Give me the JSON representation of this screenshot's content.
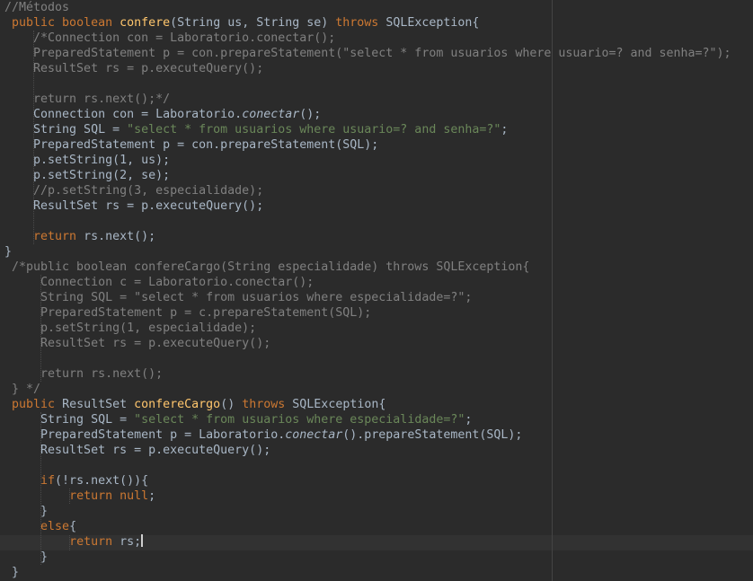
{
  "editor": {
    "colors": {
      "background": "#2b2b2b",
      "text": "#a9b7c6",
      "keyword": "#cc7832",
      "method": "#ffc66d",
      "comment": "#808080",
      "string": "#6a8759"
    },
    "cursor_line": 35,
    "lines": [
      [
        [
          "c",
          "//Métodos"
        ]
      ],
      [
        [
          "p",
          " "
        ],
        [
          "k",
          "public boolean "
        ],
        [
          "m",
          "confere"
        ],
        [
          "p",
          "(String us, String se) "
        ],
        [
          "k",
          "throws"
        ],
        [
          "p",
          " SQLException{"
        ]
      ],
      [
        [
          "c",
          "    /*Connection con = Laboratorio.conectar();"
        ]
      ],
      [
        [
          "c",
          "    PreparedStatement p = con.prepareStatement(\"select * from usuarios where usuario=? and senha=?\");"
        ]
      ],
      [
        [
          "c",
          "    ResultSet rs = p.executeQuery();"
        ]
      ],
      [],
      [
        [
          "c",
          "    return rs.next();*/"
        ]
      ],
      [
        [
          "p",
          "    Connection con = Laboratorio."
        ],
        [
          "i",
          "conectar"
        ],
        [
          "p",
          "();"
        ]
      ],
      [
        [
          "p",
          "    String SQL = "
        ],
        [
          "s",
          "\"select * from usuarios where usuario=? and senha=?\""
        ],
        [
          "p",
          ";"
        ]
      ],
      [
        [
          "p",
          "    PreparedStatement p = con.prepareStatement(SQL);"
        ]
      ],
      [
        [
          "p",
          "    p.setString(1, us);"
        ]
      ],
      [
        [
          "p",
          "    p.setString(2, se);"
        ]
      ],
      [
        [
          "c",
          "    //p.setString(3, especialidade);"
        ]
      ],
      [
        [
          "p",
          "    ResultSet rs = p.executeQuery();"
        ]
      ],
      [],
      [
        [
          "p",
          "    "
        ],
        [
          "k",
          "return"
        ],
        [
          "p",
          " rs.next();"
        ]
      ],
      [
        [
          "p",
          "}"
        ]
      ],
      [
        [
          "c",
          " /*public boolean confereCargo(String especialidade) throws SQLException{"
        ]
      ],
      [
        [
          "c",
          "     Connection c = Laboratorio.conectar();"
        ]
      ],
      [
        [
          "c",
          "     String SQL = \"select * from usuarios where especialidade=?\";"
        ]
      ],
      [
        [
          "c",
          "     PreparedStatement p = c.prepareStatement(SQL);"
        ]
      ],
      [
        [
          "c",
          "     p.setString(1, especialidade);"
        ]
      ],
      [
        [
          "c",
          "     ResultSet rs = p.executeQuery();"
        ]
      ],
      [],
      [
        [
          "c",
          "     return rs.next();"
        ]
      ],
      [
        [
          "c",
          " } */"
        ]
      ],
      [
        [
          "p",
          " "
        ],
        [
          "k",
          "public"
        ],
        [
          "p",
          " ResultSet "
        ],
        [
          "m",
          "confereCargo"
        ],
        [
          "p",
          "() "
        ],
        [
          "k",
          "throws"
        ],
        [
          "p",
          " SQLException{"
        ]
      ],
      [
        [
          "p",
          "     String SQL = "
        ],
        [
          "s",
          "\"select * from usuarios where especialidade=?\""
        ],
        [
          "p",
          ";"
        ]
      ],
      [
        [
          "p",
          "     PreparedStatement p = Laboratorio."
        ],
        [
          "i",
          "conectar"
        ],
        [
          "p",
          "().prepareStatement(SQL);"
        ]
      ],
      [
        [
          "p",
          "     ResultSet rs = p.executeQuery();"
        ]
      ],
      [],
      [
        [
          "p",
          "     "
        ],
        [
          "k",
          "if"
        ],
        [
          "p",
          "(!rs.next()){"
        ]
      ],
      [
        [
          "p",
          "         "
        ],
        [
          "k",
          "return null"
        ],
        [
          "p",
          ";"
        ]
      ],
      [
        [
          "p",
          "     }"
        ]
      ],
      [
        [
          "p",
          "     "
        ],
        [
          "k",
          "else"
        ],
        [
          "p",
          "{"
        ]
      ],
      [
        [
          "p",
          "         "
        ],
        [
          "k",
          "return"
        ],
        [
          "p",
          " rs;"
        ]
      ],
      [
        [
          "p",
          "     }"
        ]
      ],
      [
        [
          "p",
          " }"
        ]
      ]
    ]
  }
}
